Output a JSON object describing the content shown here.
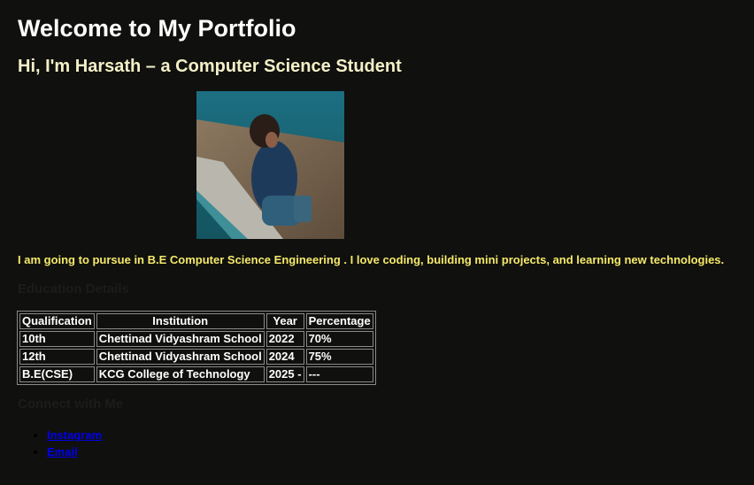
{
  "header": {
    "title": "Welcome to My Portfolio",
    "subtitle": "Hi, I'm Harsath – a Computer Science Student"
  },
  "photo": {
    "alt": "Harsath sitting by the water"
  },
  "intro": "I am going to pursue in B.E Computer Science Engineering . I love coding, building mini projects, and learning new technologies.",
  "education": {
    "heading": "Education Details",
    "columns": [
      "Qualification",
      "Institution",
      "Year",
      "Percentage"
    ],
    "rows": [
      [
        "10th",
        "Chettinad Vidyashram School",
        "2022",
        "70%"
      ],
      [
        "12th",
        "Chettinad Vidyashram School",
        "2024",
        "75%"
      ],
      [
        "B.E(CSE)",
        "KCG College of Technology",
        "2025 -",
        "---"
      ]
    ]
  },
  "connect": {
    "heading": "Connect with Me",
    "links": [
      {
        "label": "Instagram"
      },
      {
        "label": "Email"
      }
    ]
  },
  "colors": {
    "background": "#10100e",
    "subtitle": "#f3f0c8",
    "intro": "#f5e96a",
    "link": "#0000ee"
  }
}
